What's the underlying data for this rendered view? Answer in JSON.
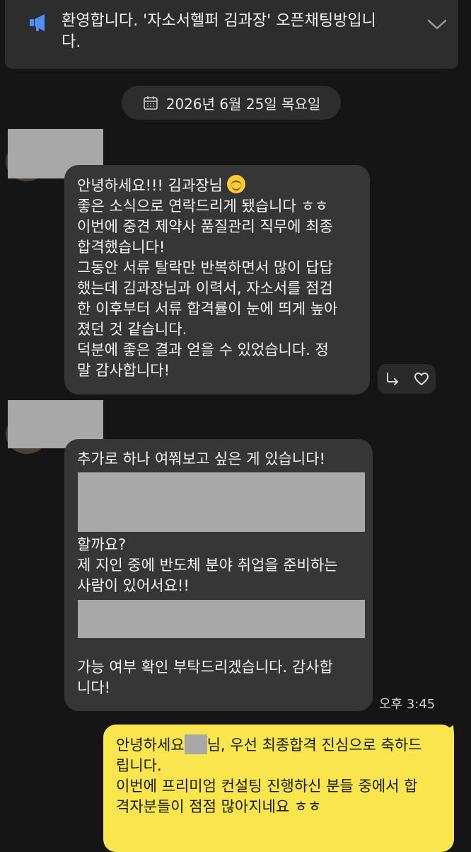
{
  "notice": {
    "line1": "환영합니다. '자소서헬퍼 김과장' 오픈채팅방입니",
    "line2": "다.",
    "icon": "megaphone-icon",
    "accent": "#4e8ff5"
  },
  "date_label": "2026년 6월 25일 목요일",
  "message1": {
    "first_line": "안녕하세요!!! 김과장님",
    "lines": [
      "좋은 소식으로 연락드리게 됐습니다 ㅎㅎ",
      "이번에 중견 제약사 품질관리 직무에 최종",
      "합격했습니다!",
      "그동안 서류 탈락만 반복하면서 많이 답답",
      "했는데 김과장님과 이력서, 자소서를 점검",
      "한 이후부터 서류 합격률이 눈에 띄게 높아",
      "졌던 것 같습니다.",
      "덕분에 좋은 결과 얻을 수 있었습니다. 정",
      "말 감사합니다!"
    ]
  },
  "message2": {
    "l1": "추가로 하나 여쭤보고 싶은 게 있습니다!",
    "l2": "할까요?",
    "l3": "제 지인 중에 반도체 분야 취업을 준비하는",
    "l4": "사람이 있어서요!!",
    "l5": "가능 여부 확인 부탁드리겠습니다. 감사합",
    "l6": "니다!"
  },
  "time": "오후 3:45",
  "reply": {
    "l1a": "안녕하세요",
    "l1b": "님, 우선 최종합격 진심으로 축하드",
    "l2": "립니다.",
    "l3": "이번에 프리미엄 컨설팅 진행하신 분들 중에서 합",
    "l4": "격자분들이 점점 많아지네요 ㅎㅎ",
    "color": "#f9e54d"
  }
}
